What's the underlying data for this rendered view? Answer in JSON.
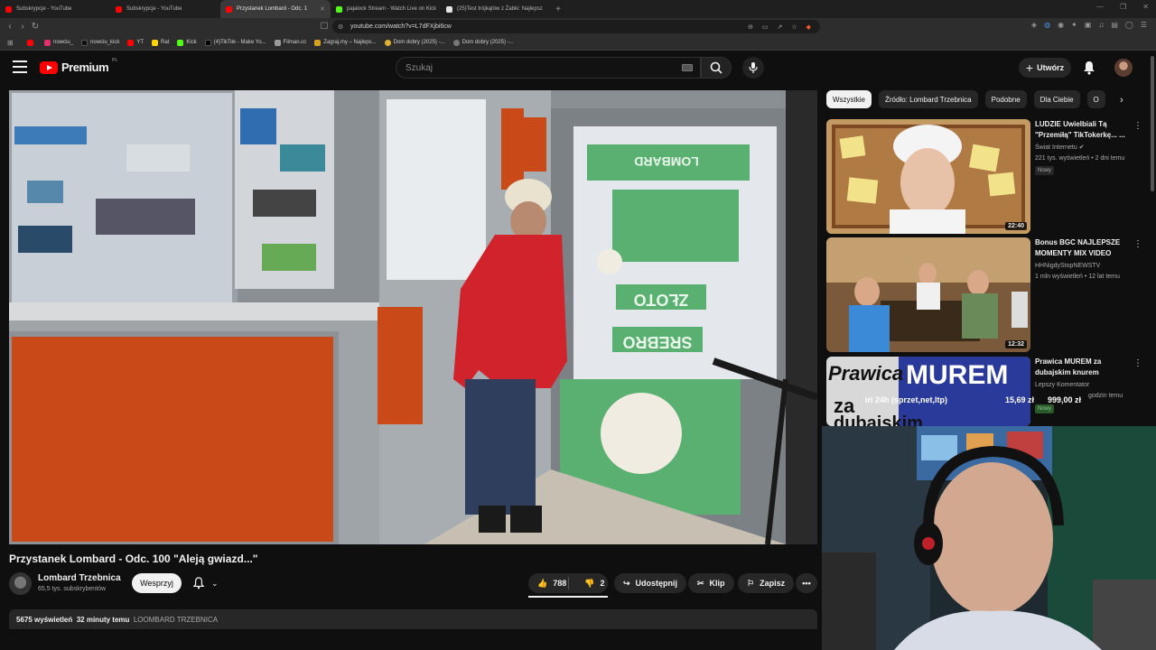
{
  "browser": {
    "tabs": [
      {
        "label": "Subskrypcje - YouTube",
        "color": "#ff0000"
      },
      {
        "label": "Subskrypcje - YouTube",
        "color": "#ff0000"
      },
      {
        "label": "Przystanek Lombard - Odc. 1",
        "color": "#ff0000",
        "active": true
      },
      {
        "label": "pajalock Stream - Watch Live on Kick",
        "color": "#53fc18"
      },
      {
        "label": "(25)Test trójkątów z Żabki: Najlepsz",
        "color": "#e5e5e5"
      }
    ],
    "new_tab_icon": "+",
    "url": "youtube.com/watch?v=L7dFXjbi6cw",
    "bookmarks": [
      {
        "label": "",
        "color": "#ff0000"
      },
      {
        "label": "nowciu_",
        "color": "#e1306c"
      },
      {
        "label": "nowciu_kick",
        "color": "#111111"
      },
      {
        "label": "YT",
        "color": "#ff0000"
      },
      {
        "label": "Rat",
        "color": "#ffd400"
      },
      {
        "label": "Kick",
        "color": "#53fc18"
      },
      {
        "label": "(4)TikTok - Make Yo...",
        "color": "#000000"
      },
      {
        "label": "Filman.cc",
        "color": "#999999"
      },
      {
        "label": "Zagraj.my – Najleps...",
        "color": "#d4a020"
      },
      {
        "label": "Dom dobry (2025) -...",
        "color": "#e0b030"
      },
      {
        "label": "Dom dobry (2025) -...",
        "color": "#777777"
      }
    ]
  },
  "header": {
    "logo_word": "Premium",
    "logo_region": "PL",
    "search_placeholder": "Szukaj",
    "create_label": "Utwórz"
  },
  "video": {
    "title": "Przystanek Lombard - Odc. 100 \"Aleją gwiazd...\"",
    "channel": "Lombard Trzebnica",
    "subscribers": "65,5 tys. subskrybentów",
    "join_label": "Wesprzyj",
    "likes": "788",
    "dislikes": "2",
    "share_label": "Udostępnij",
    "clip_label": "Klip",
    "save_label": "Zapisz",
    "views": "5675 wyświetleń",
    "time": "32 minuty temu",
    "hashtag": "LOOMBARD TRZEBNICA",
    "scene_signs": [
      "ZŁOTO",
      "SREBRO",
      "LOMBARD"
    ]
  },
  "sidebar": {
    "chips": [
      "Wszystkie",
      "Źródło: Lombard Trzebnica",
      "Podobne",
      "Dla Ciebie",
      "O"
    ],
    "recommendations": [
      {
        "title": "LUDZIE Uwielbiali Tą \"Przemiłą\" TikTokerkę... ...",
        "channel": "Świat Internetu",
        "meta": "221 tys. wyświetleń • 2 dni temu",
        "badge": "Nowy",
        "duration": "22:40"
      },
      {
        "title": "Bonus BGC NAJLEPSZE MOMENTY MIX VIDEO",
        "channel": "HHNigdyStopNEWSTV",
        "meta": "1 mln wyświetleń • 12 lat temu",
        "badge": "",
        "duration": "12:32"
      },
      {
        "title": "Prawica MUREM za dubajskim knurem",
        "channel": "Lepszy Komentator",
        "meta": "godzin temu",
        "badge": "Nowy",
        "duration": ""
      }
    ],
    "thumb3_text": [
      "Prawica",
      "MUREM",
      "za",
      "dubajskim"
    ]
  },
  "overlay": {
    "ticker_label": "iri 24h (sprzet,net,ltp)",
    "ticker_price": "15,69 zł",
    "ticker_target": "999,00 zł"
  }
}
